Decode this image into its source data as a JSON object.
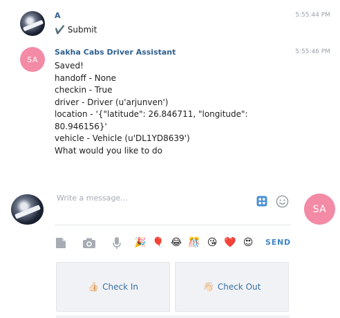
{
  "messages": [
    {
      "sender": "A",
      "time": "5:55:44 PM",
      "lines": [
        "✔️ Submit"
      ]
    },
    {
      "sender": "Sakha Cabs Driver Assistant",
      "avatar_initials": "SA",
      "time": "5:55:46 PM",
      "lines": [
        "Saved!",
        "handoff - None",
        "checkin - True",
        "driver - Driver (u'arjunven')",
        "location - '{\"latitude\": 26.846711, \"longitude\":",
        "80.946156}'",
        "vehicle - Vehicle (u'DL1YD8639')",
        "What would you like to do"
      ]
    }
  ],
  "composer": {
    "placeholder": "Write a message...",
    "bot_avatar_initials": "SA",
    "send_label": "SEND",
    "toolbar_icons": [
      "file-icon",
      "camera-icon",
      "microphone-icon"
    ],
    "emojis": [
      "🎉",
      "🎈",
      "😂",
      "🎊",
      "😘",
      "❤️",
      "😍"
    ]
  },
  "quick_replies": [
    {
      "emoji": "👍🏻",
      "label": "Check In"
    },
    {
      "emoji": "👋🏻",
      "label": "Check Out"
    }
  ],
  "colors": {
    "accent": "#3d86c6",
    "sender": "#2f5f8f",
    "avatar_pink": "#f38aa6",
    "quick_bg": "#f0f2f5"
  }
}
